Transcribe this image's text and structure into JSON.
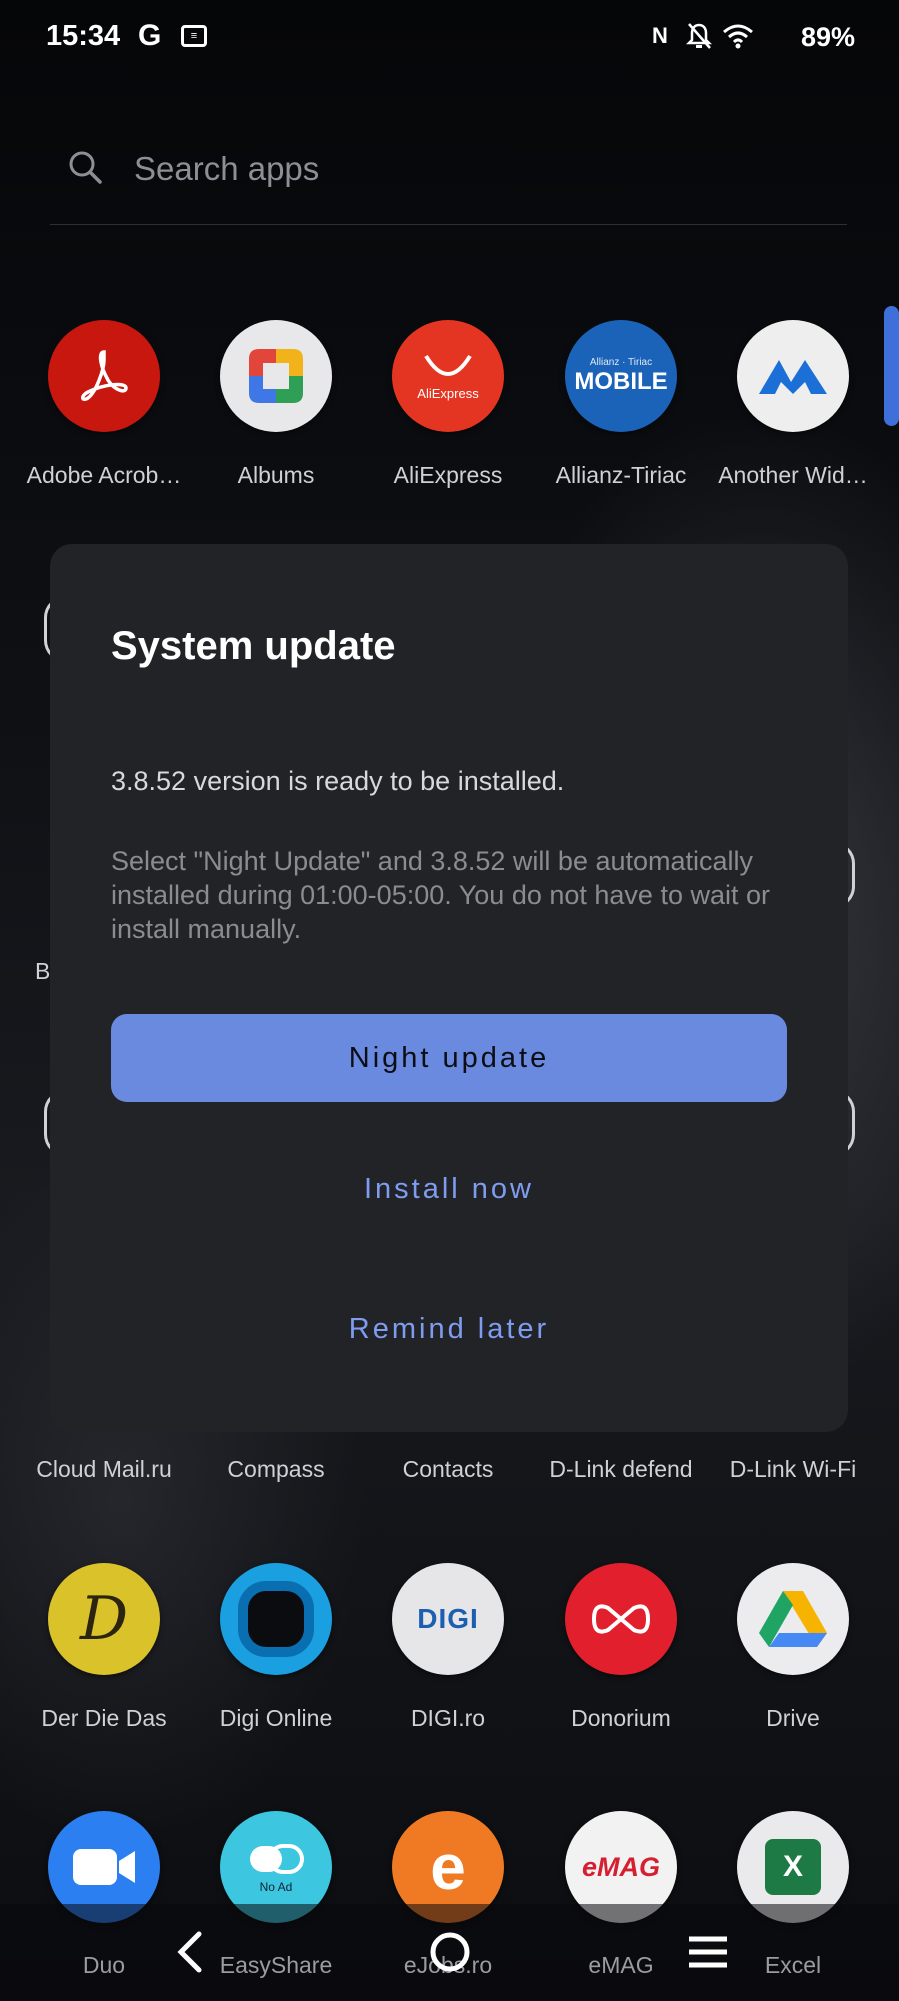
{
  "status_bar": {
    "time": "15:34",
    "battery": "89%"
  },
  "search": {
    "placeholder": "Search apps"
  },
  "apps_row1": [
    {
      "label": "Adobe Acrob…",
      "icon": "adobe-acrobat-icon",
      "color": "#c8170f"
    },
    {
      "label": "Albums",
      "icon": "albums-icon",
      "color": "#e8e8ea"
    },
    {
      "label": "AliExpress",
      "icon": "aliexpress-icon",
      "color": "#e43522"
    },
    {
      "label": "Allianz-Tiriac",
      "icon": "allianz-tiriac-icon",
      "color": "#1b63b8",
      "icon_text": "MOBILE"
    },
    {
      "label": "Another Wid…",
      "icon": "another-widget-icon",
      "color": "#eeeeef"
    }
  ],
  "apps_row5_labels": [
    "Cloud Mail.ru",
    "Compass",
    "Contacts",
    "D-Link defend",
    "D-Link Wi-Fi"
  ],
  "apps_row6": [
    {
      "label": "Der Die Das",
      "icon": "der-die-das-icon",
      "color": "#d9c22a",
      "icon_text": "D"
    },
    {
      "label": "Digi Online",
      "icon": "digi-online-icon",
      "color": "#1a9fe0"
    },
    {
      "label": "DIGI.ro",
      "icon": "digi-ro-icon",
      "color": "#e6e6e8",
      "icon_text": "DIGI"
    },
    {
      "label": "Donorium",
      "icon": "donorium-icon",
      "color": "#e21f2c"
    },
    {
      "label": "Drive",
      "icon": "google-drive-icon",
      "color": "#ececee"
    }
  ],
  "apps_row7": [
    {
      "label": "Duo",
      "icon": "duo-icon",
      "color": "#2c7ff0"
    },
    {
      "label": "EasyShare",
      "icon": "easyshare-icon",
      "color": "#3cc6e0",
      "icon_text": "No Ad"
    },
    {
      "label": "eJobs.ro",
      "icon": "ejobs-icon",
      "color": "#f07a24",
      "icon_text": "e"
    },
    {
      "label": "eMAG",
      "icon": "emag-icon",
      "color": "#f2f2f3",
      "icon_text": "eMAG"
    },
    {
      "label": "Excel",
      "icon": "excel-icon",
      "color": "#eaeaec",
      "icon_text": "X"
    }
  ],
  "dialog": {
    "title": "System update",
    "message": "3.8.52  version is ready to be installed.",
    "detail": "Select \"Night Update\" and 3.8.52  will be automatically installed during 01:00-05:00. You do not have to wait or install manually.",
    "primary_button": "Night update",
    "secondary_button": "Install now",
    "tertiary_button": "Remind later",
    "accent_color": "#6a8ae0"
  }
}
